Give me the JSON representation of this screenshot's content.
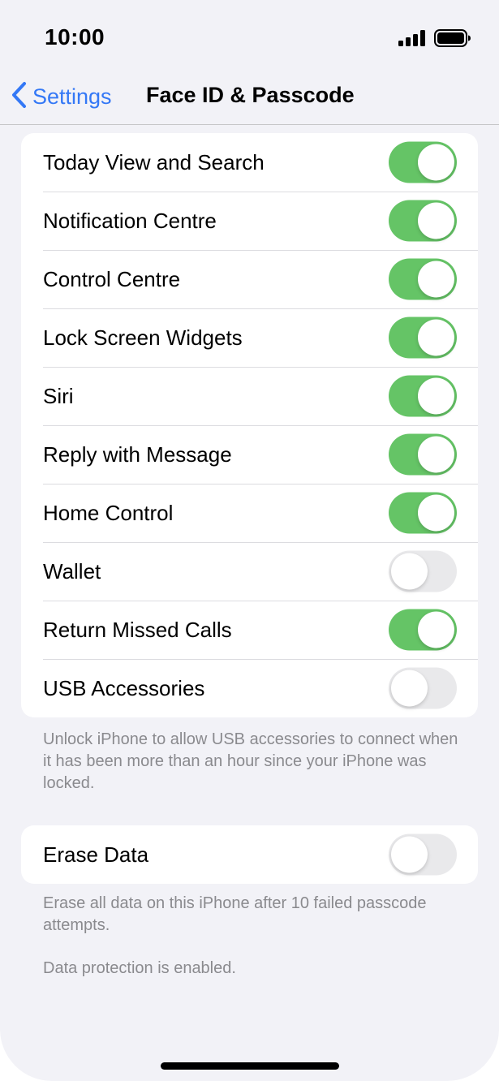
{
  "status_bar": {
    "time": "10:00"
  },
  "nav": {
    "back_label": "Settings",
    "title": "Face ID & Passcode"
  },
  "allow_access_group": {
    "items": [
      {
        "label": "Today View and Search",
        "on": true
      },
      {
        "label": "Notification Centre",
        "on": true
      },
      {
        "label": "Control Centre",
        "on": true
      },
      {
        "label": "Lock Screen Widgets",
        "on": true
      },
      {
        "label": "Siri",
        "on": true
      },
      {
        "label": "Reply with Message",
        "on": true
      },
      {
        "label": "Home Control",
        "on": true
      },
      {
        "label": "Wallet",
        "on": false
      },
      {
        "label": "Return Missed Calls",
        "on": true
      },
      {
        "label": "USB Accessories",
        "on": false
      }
    ],
    "footnote": "Unlock iPhone to allow USB accessories to connect when it has been more than an hour since your iPhone was locked."
  },
  "erase_group": {
    "label": "Erase Data",
    "on": false,
    "footnote_1": "Erase all data on this iPhone after 10 failed passcode attempts.",
    "footnote_2": "Data protection is enabled."
  },
  "colors": {
    "toggle_on": "#65c466",
    "toggle_off": "#e9e9eb",
    "accent_blue": "#3478f6",
    "background": "#f2f2f7",
    "footnote_gray": "#8a8a8e"
  },
  "icons": {
    "back": "chevron-left-icon",
    "signal": "cellular-signal-icon",
    "battery": "battery-icon"
  }
}
